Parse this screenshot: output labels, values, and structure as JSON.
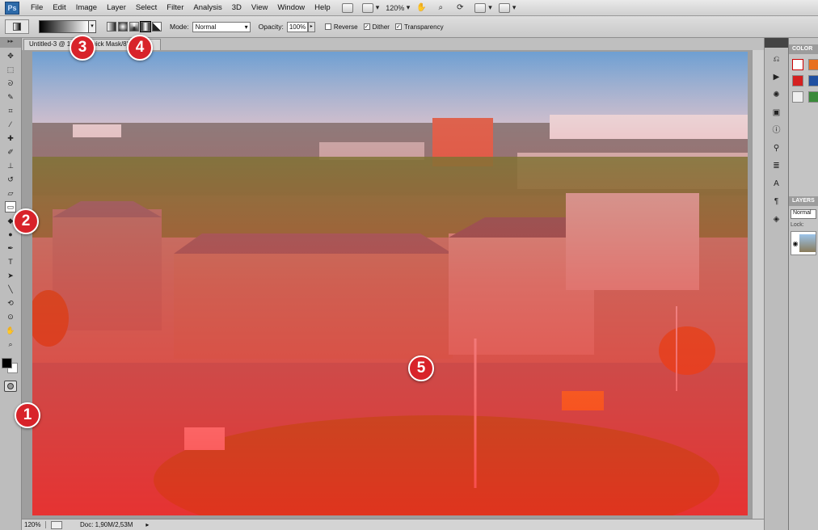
{
  "app": {
    "logo": "Ps"
  },
  "menu": [
    "File",
    "Edit",
    "Image",
    "Layer",
    "Select",
    "Filter",
    "Analysis",
    "3D",
    "View",
    "Window",
    "Help"
  ],
  "menu_tools": {
    "zoom": "120%"
  },
  "options": {
    "mode_label": "Mode:",
    "mode_value": "Normal",
    "opacity_label": "Opacity:",
    "opacity_value": "100%",
    "reverse_label": "Reverse",
    "reverse_checked": false,
    "dither_label": "Dither",
    "dither_checked": true,
    "transparency_label": "Transparency",
    "transparency_checked": true
  },
  "document": {
    "tab_title": "Untitled-3 @ 120% (Quick Mask/8)"
  },
  "status": {
    "zoom": "120%",
    "doc": "Doc: 1,90M/2,53M"
  },
  "panels": {
    "color_tab": "COLOR",
    "layers_tab": "LAYERS",
    "layers_blend": "Normal",
    "layers_lock": "Lock:"
  },
  "badges": [
    "1",
    "2",
    "3",
    "4",
    "5"
  ],
  "colors": {
    "quickmask_overlay": "#ff2020",
    "foreground": "#000000",
    "background": "#ffffff",
    "badge": "#d8232a"
  }
}
